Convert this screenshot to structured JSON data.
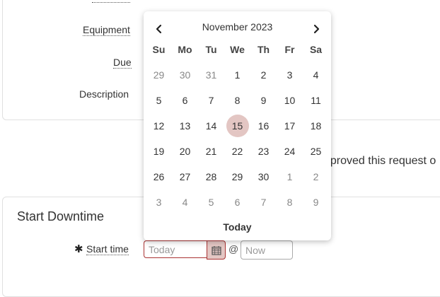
{
  "form": {
    "equipment_label": "Equipment",
    "due_label": "Due",
    "description_label": "Description",
    "approved_text": "pproved this request o"
  },
  "start_downtime": {
    "title": "Start Downtime",
    "required_mark": "✱",
    "start_time_label": "Start time",
    "date_placeholder": "Today",
    "at_sign": "@",
    "time_placeholder": "Now"
  },
  "datepicker": {
    "month_label": "November 2023",
    "weekdays": [
      "Su",
      "Mo",
      "Tu",
      "We",
      "Th",
      "Fr",
      "Sa"
    ],
    "weeks": [
      [
        "29",
        "30",
        "31",
        "1",
        "2",
        "3",
        "4"
      ],
      [
        "5",
        "6",
        "7",
        "8",
        "9",
        "10",
        "11"
      ],
      [
        "12",
        "13",
        "14",
        "15",
        "16",
        "17",
        "18"
      ],
      [
        "19",
        "20",
        "21",
        "22",
        "23",
        "24",
        "25"
      ],
      [
        "26",
        "27",
        "28",
        "29",
        "30",
        "1",
        "2"
      ],
      [
        "3",
        "4",
        "5",
        "6",
        "7",
        "8",
        "9"
      ]
    ],
    "muted": [
      [
        true,
        true,
        true,
        false,
        false,
        false,
        false
      ],
      [
        false,
        false,
        false,
        false,
        false,
        false,
        false
      ],
      [
        false,
        false,
        false,
        false,
        false,
        false,
        false
      ],
      [
        false,
        false,
        false,
        false,
        false,
        false,
        false
      ],
      [
        false,
        false,
        false,
        false,
        false,
        true,
        true
      ],
      [
        true,
        true,
        true,
        true,
        true,
        true,
        true
      ]
    ],
    "selected_day": "15",
    "today_label": "Today"
  },
  "colors": {
    "accent": "#e3c6c3",
    "error_border": "#aa3333"
  },
  "icons": {
    "prev": "chevron-left-icon",
    "next": "chevron-right-icon",
    "calendar": "calendar-icon"
  }
}
